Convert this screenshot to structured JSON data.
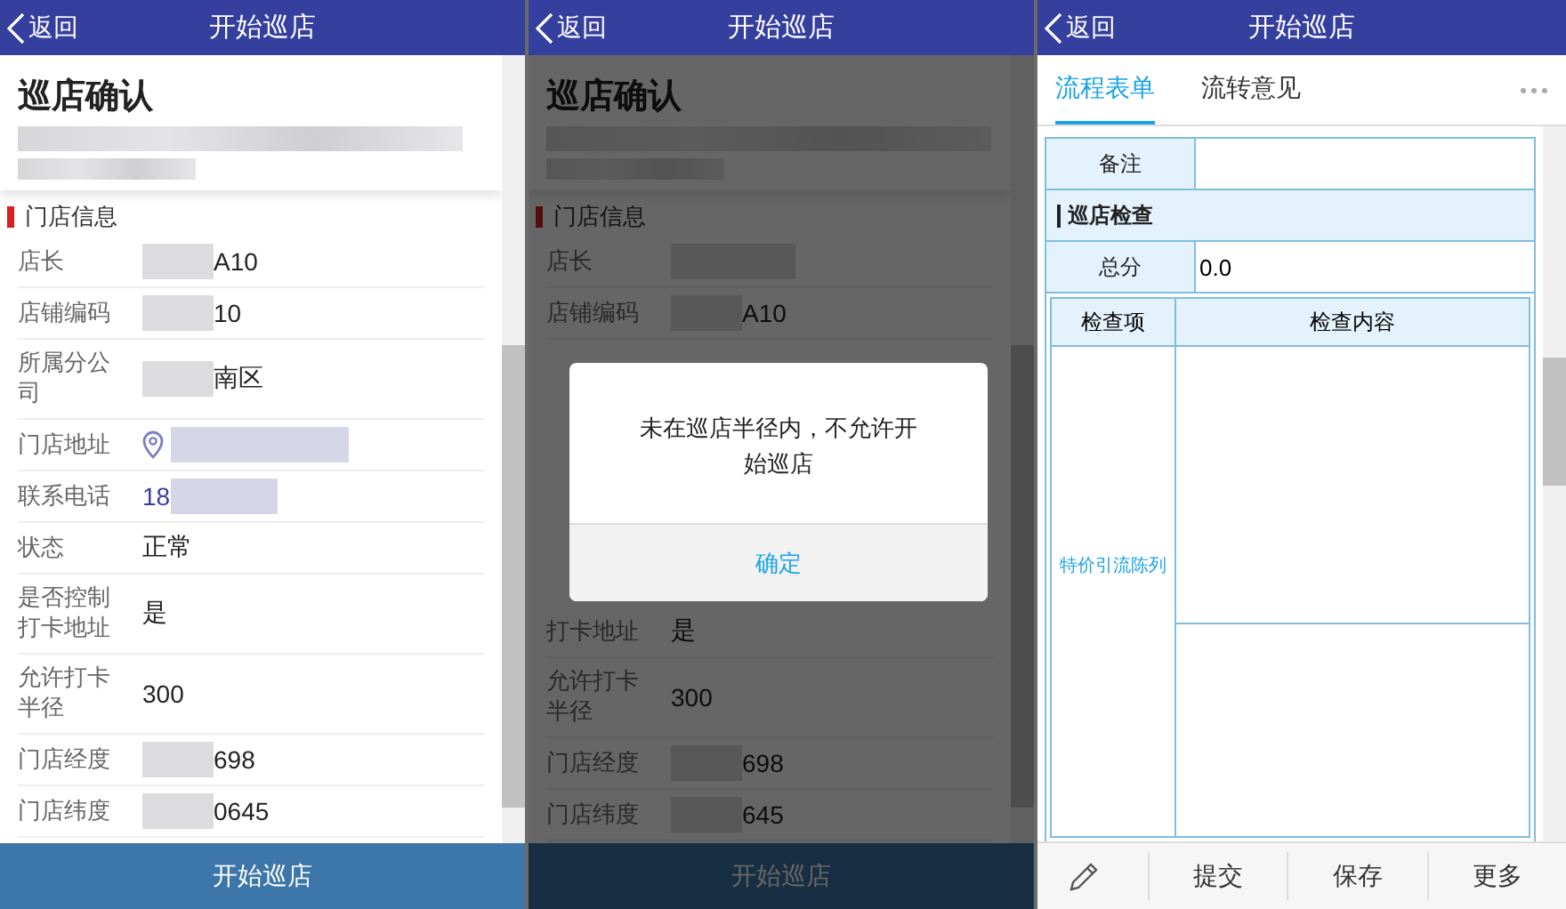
{
  "panes": [
    {
      "header": {
        "back": "返回",
        "title": "开始巡店"
      },
      "card_title": "巡店确认",
      "section": "门店信息",
      "button": "开始巡店",
      "rows": [
        {
          "kind": "row",
          "label": "店长",
          "value": "A10",
          "mask_before": true
        },
        {
          "kind": "row",
          "label": "店铺编码",
          "value": "10",
          "mask_before": true
        },
        {
          "kind": "row",
          "label": "所属分公司",
          "value": "南区",
          "mask_before": true
        },
        {
          "kind": "address",
          "label": "门店地址",
          "mask_after": true
        },
        {
          "kind": "row",
          "label": "联系电话",
          "value": "18",
          "mask_after": true,
          "link": true
        },
        {
          "kind": "row",
          "label": "状态",
          "value": "正常"
        },
        {
          "kind": "row",
          "label": "是否控制打卡地址",
          "value": "是"
        },
        {
          "kind": "row",
          "label": "允许打卡半径",
          "value": "300"
        },
        {
          "kind": "row",
          "label": "门店经度",
          "value": "698",
          "mask_before": true
        },
        {
          "kind": "row",
          "label": "门店纬度",
          "value": "0645",
          "mask_before": true
        }
      ]
    },
    {
      "header": {
        "back": "返回",
        "title": "开始巡店"
      },
      "dimmed": true,
      "card_title": "巡店确认",
      "section": "门店信息",
      "button": "开始巡店",
      "dialog": {
        "message": "未在巡店半径内，不允许开始巡店",
        "confirm": "确定"
      },
      "rows": [
        {
          "kind": "row",
          "label": "店长",
          "mask_before": true
        },
        {
          "kind": "row",
          "label": "店铺编码",
          "value": "A10",
          "mask_before": true
        },
        {
          "kind": "covered"
        },
        {
          "kind": "row",
          "label": "打卡地址",
          "value": "是"
        },
        {
          "kind": "row",
          "label": "允许打卡半径",
          "value": "300"
        },
        {
          "kind": "row",
          "label": "门店经度",
          "value": "698",
          "mask_before": true
        },
        {
          "kind": "row",
          "label": "门店纬度",
          "value": "645",
          "mask_before": true
        }
      ]
    }
  ],
  "form_pane": {
    "header": {
      "back": "返回",
      "title": "开始巡店"
    },
    "tabs": [
      {
        "label": "流程表单",
        "selected": true
      },
      {
        "label": "流转意见",
        "selected": false
      }
    ],
    "form_rows": [
      {
        "kind": "field",
        "label": "备注"
      },
      {
        "kind": "section",
        "label": "巡店检查"
      },
      {
        "kind": "field",
        "label": "总分",
        "value": "0.0"
      }
    ],
    "check_table": {
      "columns": [
        "检查项",
        "检查内容"
      ],
      "rows": [
        {
          "item": "特价引流陈列"
        }
      ]
    },
    "toolbar": [
      "提交",
      "保存",
      "更多"
    ]
  }
}
